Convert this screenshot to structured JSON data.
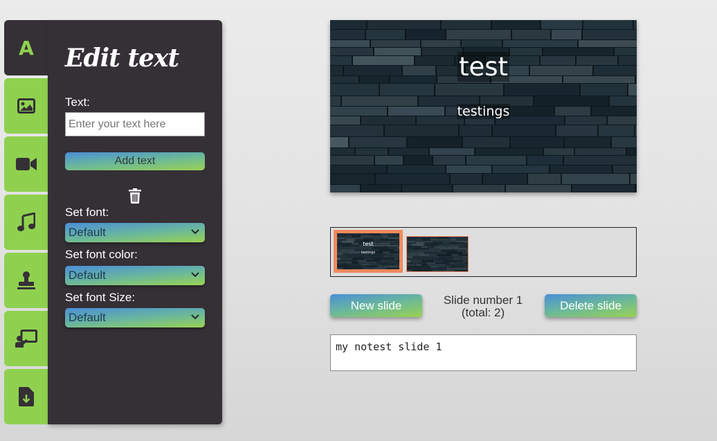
{
  "tabs": [
    {
      "name": "text-tab",
      "icon": "letter-a-icon",
      "active": true
    },
    {
      "name": "image-tab",
      "icon": "image-icon"
    },
    {
      "name": "video-tab",
      "icon": "video-camera-icon"
    },
    {
      "name": "music-tab",
      "icon": "music-note-icon"
    },
    {
      "name": "stamp-tab",
      "icon": "stamp-icon"
    },
    {
      "name": "presenter-tab",
      "icon": "presenter-icon"
    },
    {
      "name": "export-tab",
      "icon": "file-download-icon"
    }
  ],
  "tab_letter": "A",
  "panel": {
    "title": "Edit text",
    "text_label": "Text:",
    "text_placeholder": "Enter your text here",
    "add_text_label": "Add text",
    "font_label": "Set font:",
    "font_value": "Default",
    "color_label": "Set font color:",
    "color_value": "Default",
    "size_label": "Set font Size:",
    "size_value": "Default"
  },
  "slide": {
    "title": "test",
    "subtitle": "testings"
  },
  "thumbnails": [
    {
      "title": "test",
      "subtitle": "testings",
      "selected": true
    },
    {
      "title": "",
      "subtitle": "",
      "selected": false
    }
  ],
  "controls": {
    "new_slide_label": "New slide",
    "slide_number_line1": "Slide number 1",
    "slide_number_line2": "(total: 2)",
    "delete_slide_label": "Delete slide"
  },
  "notes_value": "my notest slide 1",
  "colors": {
    "tab_green": "#8fd14f",
    "panel_dark": "#353036",
    "thumb_selected_border": "#f08a5d",
    "gradient_blue": "#4a8fd8",
    "gradient_green": "#9ad252"
  }
}
